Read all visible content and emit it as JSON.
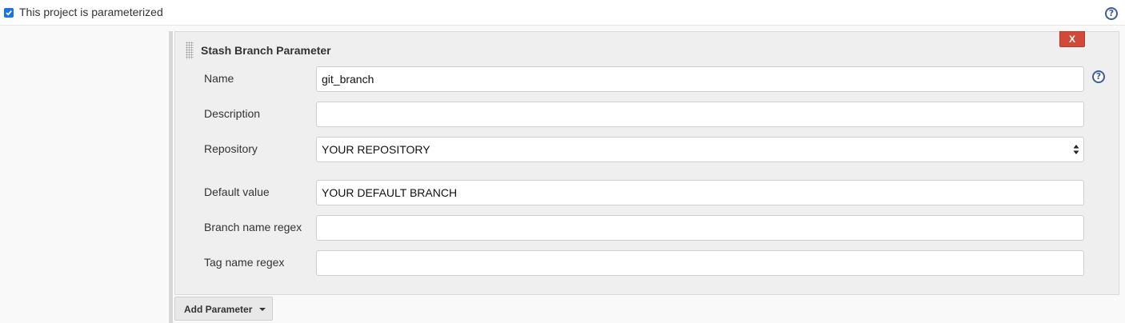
{
  "project": {
    "parameterized_label": "This project is parameterized",
    "parameterized_checked": true
  },
  "parameter": {
    "title": "Stash Branch Parameter",
    "delete_label": "X",
    "fields": {
      "name": {
        "label": "Name",
        "value": "git_branch"
      },
      "description": {
        "label": "Description",
        "value": ""
      },
      "repository": {
        "label": "Repository",
        "value": "YOUR REPOSITORY"
      },
      "default_value": {
        "label": "Default value",
        "value": "YOUR DEFAULT BRANCH"
      },
      "branch_regex": {
        "label": "Branch name regex",
        "value": ""
      },
      "tag_regex": {
        "label": "Tag name regex",
        "value": ""
      }
    }
  },
  "actions": {
    "add_parameter_label": "Add Parameter"
  },
  "icons": {
    "help": "help-icon",
    "checkbox": "checkbox-checked-icon",
    "caret": "chevron-down-icon",
    "drag": "drag-handle-icon"
  },
  "colors": {
    "delete_button": "#d24939",
    "help_icon": "#3d5c9c",
    "checkbox": "#1a73e8"
  }
}
